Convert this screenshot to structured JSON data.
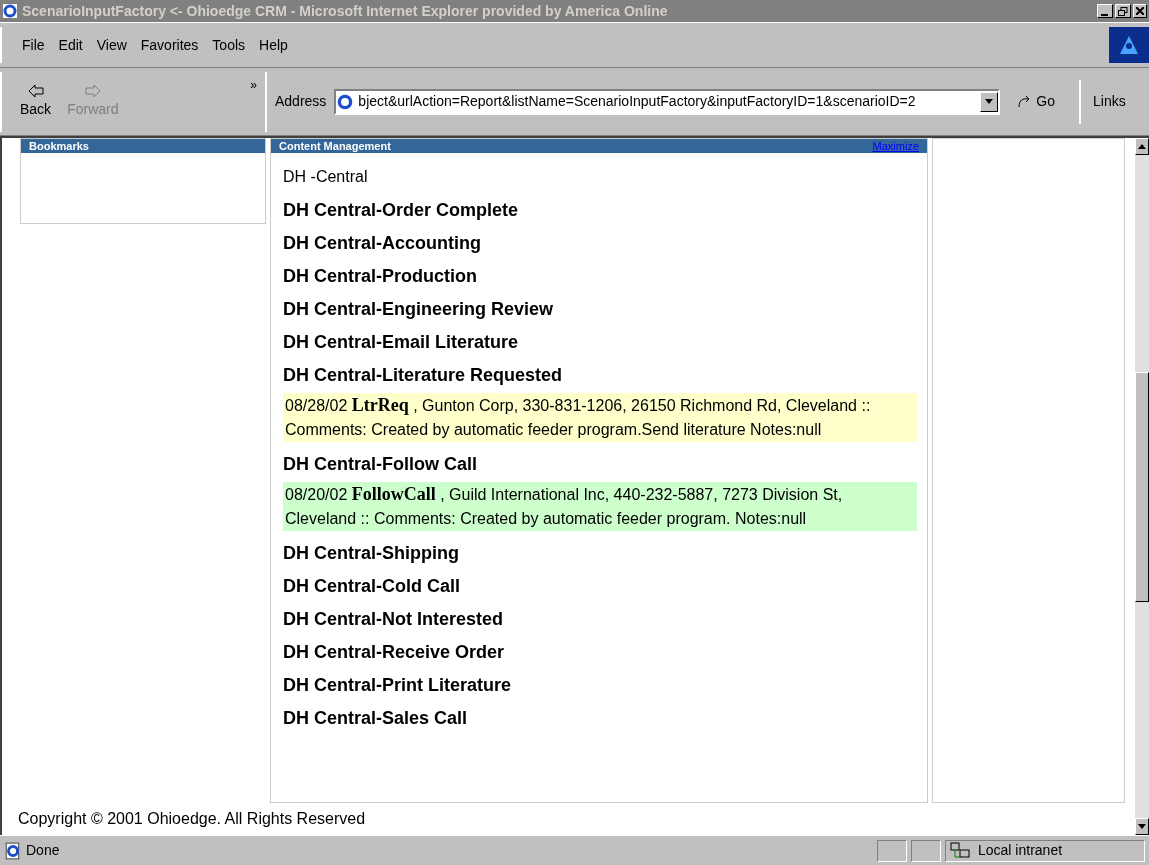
{
  "window": {
    "title": "ScenarioInputFactory <- Ohioedge CRM - Microsoft Internet Explorer provided by America Online"
  },
  "menu": [
    "File",
    "Edit",
    "View",
    "Favorites",
    "Tools",
    "Help"
  ],
  "toolbar": {
    "buttons": [
      {
        "label": "Back",
        "disabled": false
      },
      {
        "label": "Forward",
        "disabled": true
      }
    ],
    "address_label": "Address",
    "address": "bject&urlAction=Report&listName=ScenarioInputFactory&inputFactoryID=1&scenarioID=2",
    "go": "Go",
    "links": "Links",
    "more": "»"
  },
  "sidebar": {
    "title": "Bookmarks"
  },
  "content": {
    "title": "Content Management",
    "action": "Maximize",
    "entries": [
      {
        "kind": "heading",
        "text": "DH -Central"
      },
      {
        "kind": "stage",
        "text": "DH Central-Order Complete"
      },
      {
        "kind": "stage",
        "text": "DH Central-Accounting"
      },
      {
        "kind": "stage",
        "text": "DH Central-Production"
      },
      {
        "kind": "stage",
        "text": "DH Central-Engineering Review"
      },
      {
        "kind": "stage",
        "text": "DH Central-Email Literature"
      },
      {
        "kind": "stage",
        "text": "DH Central-Literature Requested"
      },
      {
        "kind": "record",
        "color": "#ffffcc",
        "text": "08/28/02 **LtrReq** , Gunton Corp, 330-831-1206, 26150 Richmond Rd, Cleveland :: Comments: Created by automatic feeder program.Send literature Notes:null"
      },
      {
        "kind": "stage",
        "text": "DH Central-Follow Call"
      },
      {
        "kind": "record",
        "color": "#ccffcc",
        "text": "08/20/02 **FollowCall** , Guild International Inc, 440-232-5887, 7273 Division St, Cleveland :: Comments: Created by automatic feeder program. Notes:null"
      },
      {
        "kind": "stage",
        "text": "DH Central-Shipping"
      },
      {
        "kind": "stage",
        "text": "DH Central-Cold Call"
      },
      {
        "kind": "stage",
        "text": "DH Central-Not Interested"
      },
      {
        "kind": "stage",
        "text": "DH Central-Receive Order"
      },
      {
        "kind": "stage",
        "text": "DH Central-Print Literature"
      },
      {
        "kind": "stage",
        "text": "DH Central-Sales Call"
      }
    ]
  },
  "footer": "Copyright © 2001 Ohioedge. All Rights Reserved",
  "status_bar": {
    "text": "Done",
    "zone": "Local intranet"
  }
}
